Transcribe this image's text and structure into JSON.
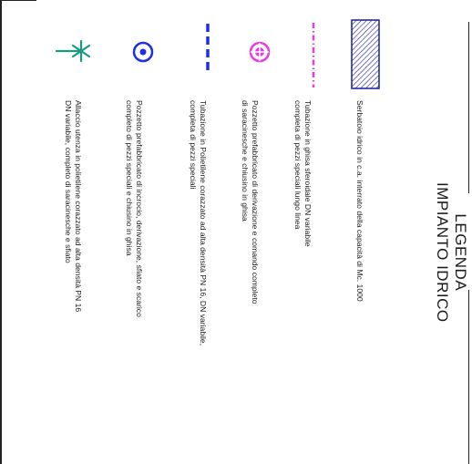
{
  "legend": {
    "title_line1": "LEGENDA",
    "title_line2": "IMPIANTO IDRICO"
  },
  "entries": [
    {
      "symbol": "hatched-rectangle",
      "line1": "Serbatoio idrico in c.a. interrato della capacità di Mc. 1000",
      "line2": ""
    },
    {
      "symbol": "magenta-dash-dot-line",
      "line1": "Tubazione in ghisa sferoidale DN variabile",
      "line2": "completa di pezzi speciali lungo linea"
    },
    {
      "symbol": "magenta-circle-cross",
      "line1": "Pozzetto prefabbricato di derivazione e comando completo",
      "line2": "di saracinesche e chiusino in ghisa"
    },
    {
      "symbol": "blue-dashed-line",
      "line1": "Tubazione in Polietilene corazzato ad alta densità PN 16, DN variabile,",
      "line2": "completa di pezzi speciali"
    },
    {
      "symbol": "blue-double-circle",
      "line1": "Pozzetto prefabbricato di incrocio, derivazione, sfiato e scarico",
      "line2": "completo di pezzi speciali e chiusino in ghisa"
    },
    {
      "symbol": "teal-asterisk-connector",
      "line1": "Allaccio utenza in polietilene corazzato ad alta densità PN 16",
      "line2": "DN variabile, completo di saracinesche e sfiato"
    }
  ],
  "colors": {
    "magenta": "#e83be8",
    "blue": "#1f2ee0",
    "navy": "#1a1f9e",
    "teal": "#1a9a82",
    "frame": "#222222"
  }
}
